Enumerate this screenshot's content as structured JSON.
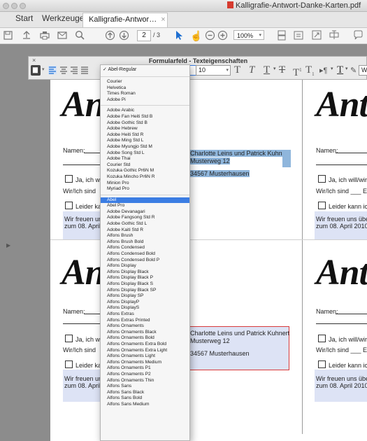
{
  "window": {
    "title": "Kalligrafie-Antwort-Danke-Karten.pdf"
  },
  "tabs": {
    "start": "Start",
    "tools": "Werkzeuge",
    "document": "Kalligrafie-Antwor…",
    "close": "×"
  },
  "toolbar": {
    "page_current": "2",
    "page_total": "/ 3",
    "zoom": "100%"
  },
  "form_panel": {
    "title": "Formularfeld - Texteigenschaften",
    "close": "×",
    "font_size": "10",
    "font_field_right": "We"
  },
  "card": {
    "title_fragment": "Ant",
    "name_label": "Namen:",
    "yes_text_left": "Ja, ich wil",
    "yes_text_right": "Ja, ich will/wir w",
    "we_left": "Wir/Ich sind",
    "we_right": "Wir/Ich sind ___ Er",
    "decline_left": "Leider kar",
    "decline_right": "Leider kann ich/",
    "note_line1_left": "Wir freuen uns",
    "note_line2_left": "zum 08. April 2",
    "note_line1_right": "Wir freuen uns über",
    "note_line2_right": "zum 08. April 2010.",
    "address_line1": "Charlotte Leins und Patrick Kuhnert",
    "address_line2": "Musterweg 12",
    "address_line3": "34567 Musterhausen"
  },
  "font_dropdown": {
    "selected_top": "Abel-Regular",
    "group1": [
      "Courier",
      "Helvetica",
      "Times Roman",
      "Adobe Pi"
    ],
    "group2": [
      "Adobe Arabic",
      "Adobe Fan Heiti Std B",
      "Adobe Gothic Std B",
      "Adobe Hebrew",
      "Adobe Heiti Std R",
      "Adobe Ming Std L",
      "Adobe Myungjo Std M",
      "Adobe Song Std L",
      "Adobe Thai",
      "Courier Std",
      "Kozuka Gothic Pr6N M",
      "Kozuka Mincho Pr6N R",
      "Minion Pro",
      "Myriad Pro"
    ],
    "highlighted": "Abel",
    "group3": [
      "Abel Pro",
      "Adobe Devanagari",
      "Adobe Fangsong Std R",
      "Adobe Gothic Std L",
      "Adobe Kaiti Std R",
      "Alfons Brush",
      "Alfons Brush Bold",
      "Alfons Condensed",
      "Alfons Condensed Bold",
      "Alfons Condensed Bold P",
      "Alfons Display",
      "Alfons Display Black",
      "Alfons Display Black P",
      "Alfons Display Black S",
      "Alfons Display Black SP",
      "Alfons Display SP",
      "Alfons DisplayP",
      "Alfons DisplayS",
      "Alfons Extras",
      "Alfons Extras Printed",
      "Alfons Ornaments",
      "Alfons Ornaments Black",
      "Alfons Ornaments Bold",
      "Alfons Ornaments Extra Bold",
      "Alfons Ornaments Extra Light",
      "Alfons Ornaments Light",
      "Alfons Ornaments Medium",
      "Alfons Ornaments P1",
      "Alfons Ornaments P2",
      "Alfons Ornaments Thin",
      "Alfons Sans",
      "Alfons Sans Black",
      "Alfons Sans Bold",
      "Alfons Sans Medium"
    ]
  },
  "colors": {
    "selection": "#3b7de3",
    "field_fill": "#dde3f5",
    "highlight": "#8fb6dc",
    "active_border": "#d83b3b"
  }
}
